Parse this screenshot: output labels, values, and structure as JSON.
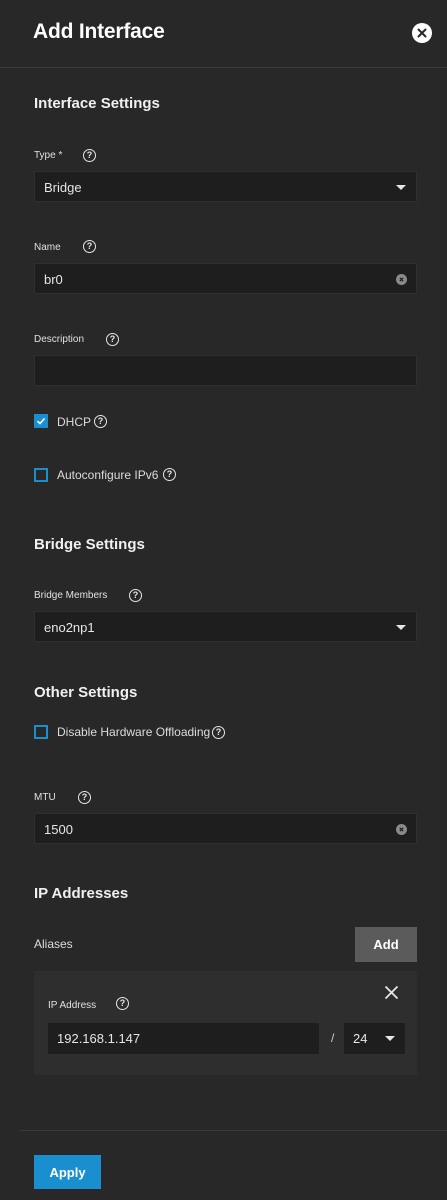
{
  "header": {
    "title": "Add Interface",
    "close_icon": "close-icon"
  },
  "interface_settings": {
    "title": "Interface Settings",
    "type": {
      "label": "Type *",
      "value": "Bridge"
    },
    "name": {
      "label": "Name",
      "value": "br0"
    },
    "description": {
      "label": "Description",
      "value": ""
    },
    "dhcp": {
      "label": "DHCP",
      "checked": true
    },
    "autoconfigure_ipv6": {
      "label": "Autoconfigure IPv6",
      "checked": false
    }
  },
  "bridge_settings": {
    "title": "Bridge Settings",
    "bridge_members": {
      "label": "Bridge Members",
      "value": "eno2np1"
    }
  },
  "other_settings": {
    "title": "Other Settings",
    "disable_hw_offloading": {
      "label": "Disable Hardware Offloading",
      "checked": false
    },
    "mtu": {
      "label": "MTU",
      "value": "1500"
    }
  },
  "ip_addresses": {
    "title": "IP Addresses",
    "aliases_label": "Aliases",
    "add_label": "Add",
    "alias": {
      "label": "IP Address",
      "ip": "192.168.1.147",
      "separator": "/",
      "netmask": "24"
    }
  },
  "footer": {
    "apply_label": "Apply"
  },
  "colors": {
    "accent": "#1a8fd0",
    "background": "#282828",
    "field": "#1e1e1e"
  }
}
